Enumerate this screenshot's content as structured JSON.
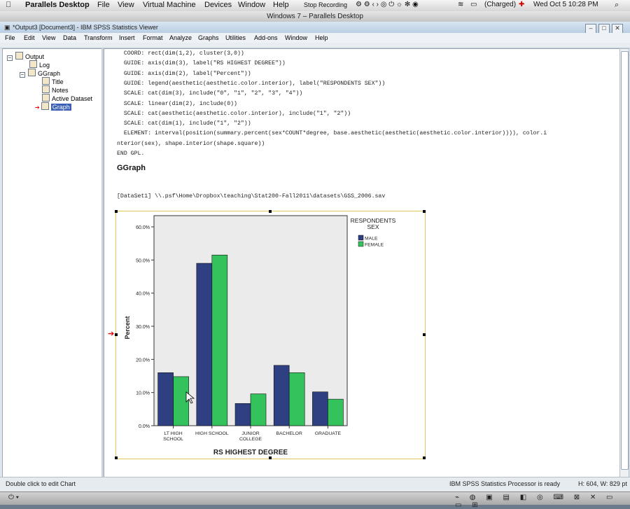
{
  "mac_menubar": {
    "apple": "",
    "app_name": "Parallels Desktop",
    "menus": [
      "File",
      "View",
      "Virtual Machine",
      "Devices",
      "Window",
      "Help"
    ],
    "recording": "Stop Recording",
    "battery": "(Charged)",
    "datetime": "Wed Oct 5  10:28 PM"
  },
  "parallels_title": "Windows 7 – Parallels Desktop",
  "spss": {
    "title": "*Output3 [Document3] - IBM SPSS Statistics Viewer",
    "menus": [
      "File",
      "Edit",
      "View",
      "Data",
      "Transform",
      "Insert",
      "Format",
      "Analyze",
      "Graphs",
      "Utilities",
      "Add-ons",
      "Window",
      "Help"
    ],
    "outline": [
      {
        "label": "Output",
        "level": 0
      },
      {
        "label": "Log",
        "level": 1
      },
      {
        "label": "GGraph",
        "level": 1
      },
      {
        "label": "Title",
        "level": 2
      },
      {
        "label": "Notes",
        "level": 2
      },
      {
        "label": "Active Dataset",
        "level": 2
      },
      {
        "label": "Graph",
        "level": 2,
        "selected": true
      }
    ],
    "syntax_lines": [
      "  COORD: rect(dim(1,2), cluster(3,0))",
      "  GUIDE: axis(dim(3), label(\"RS HIGHEST DEGREE\"))",
      "  GUIDE: axis(dim(2), label(\"Percent\"))",
      "  GUIDE: legend(aesthetic(aesthetic.color.interior), label(\"RESPONDENTS SEX\"))",
      "  SCALE: cat(dim(3), include(\"0\", \"1\", \"2\", \"3\", \"4\"))",
      "  SCALE: linear(dim(2), include(0))",
      "  SCALE: cat(aesthetic(aesthetic.color.interior), include(\"1\", \"2\"))",
      "  SCALE: cat(dim(1), include(\"1\", \"2\"))",
      "  ELEMENT: interval(position(summary.percent(sex*COUNT*degree, base.aesthetic(aesthetic(aesthetic.color.interior)))), color.i",
      "nterior(sex), shape.interior(shape.square))",
      "END GPL."
    ],
    "section_title": "GGraph",
    "dataset_line": "[DataSet1] \\\\.psf\\Home\\Dropbox\\teaching\\Stat200-Fall2011\\datasets\\GSS_2006.sav",
    "status_left": "Double click to edit Chart",
    "status_mid": "IBM SPSS Statistics Processor is ready",
    "status_right": "H: 604, W: 829 pt"
  },
  "chart_data": {
    "type": "bar",
    "categories": [
      "LT HIGH SCHOOL",
      "HIGH SCHOOL",
      "JUNIOR COLLEGE",
      "BACHELOR",
      "GRADUATE"
    ],
    "category_labels": [
      [
        "LT HIGH",
        "SCHOOL"
      ],
      [
        "HIGH SCHOOL"
      ],
      [
        "JUNIOR",
        "COLLEGE"
      ],
      [
        "BACHELOR"
      ],
      [
        "GRADUATE"
      ]
    ],
    "series": [
      {
        "name": "MALE",
        "values": [
          16.0,
          49.0,
          6.7,
          18.2,
          10.2
        ]
      },
      {
        "name": "FEMALE",
        "values": [
          14.8,
          51.5,
          9.6,
          16.0,
          8.0
        ]
      }
    ],
    "colors": {
      "MALE": "#2e3f82",
      "FEMALE": "#34c25d"
    },
    "xlabel": "RS HIGHEST DEGREE",
    "ylabel": "Percent",
    "legend_title": "RESPONDENTS SEX",
    "legend_position": "top-right",
    "ylim": [
      0,
      60
    ],
    "yticks": [
      "0.0%",
      "10.0%",
      "20.0%",
      "30.0%",
      "40.0%",
      "50.0%",
      "60.0%"
    ],
    "tick_values": [
      0,
      10,
      20,
      30,
      40,
      50,
      60
    ],
    "plot_background": "#ebebeb"
  },
  "parallels_bottom": {
    "power": "⏻ ▾"
  }
}
